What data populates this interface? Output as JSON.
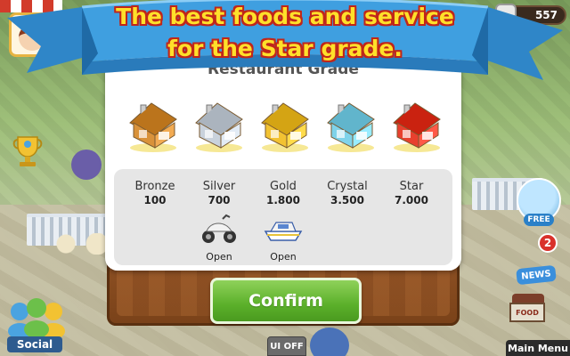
{
  "banner": {
    "line1": "The best foods and service",
    "line2": "for the Star grade."
  },
  "dialog": {
    "title": "Restaurant Grade",
    "grades": [
      {
        "name": "Bronze",
        "value": "100",
        "color": "#d9923a",
        "reward": "",
        "status": ""
      },
      {
        "name": "Silver",
        "value": "700",
        "color": "#c9d2dc",
        "reward": "scooter-icon",
        "status": "Open"
      },
      {
        "name": "Gold",
        "value": "1.800",
        "color": "#f2c232",
        "reward": "boat-icon",
        "status": "Open"
      },
      {
        "name": "Crystal",
        "value": "3.500",
        "color": "#7fd3ea",
        "reward": "",
        "status": ""
      },
      {
        "name": "Star",
        "value": "7.000",
        "color": "#e8402e",
        "reward": "",
        "status": ""
      }
    ],
    "confirm_label": "Confirm"
  },
  "hud": {
    "coins": "557",
    "notification_count": "2",
    "social_label": "Social",
    "ui_off_label": "UI OFF",
    "free_label": "FREE",
    "news_count": "2",
    "news_label": "NEWS",
    "food_label": "FOOD",
    "main_menu_label": "Main Menu"
  },
  "colors": {
    "banner_ribbon": "#3f9fe0",
    "banner_text": "#ffe02a",
    "banner_outline": "#c0261a",
    "confirm_button": "#5bb02a",
    "dialog_frame": "#8a4b1f"
  }
}
